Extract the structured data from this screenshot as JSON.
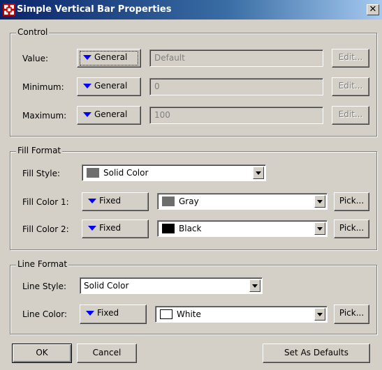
{
  "window": {
    "title": "Simple Vertical Bar Properties",
    "close_glyph": "✕"
  },
  "control": {
    "group_title": "Control",
    "rows": [
      {
        "label": "Value:",
        "mode": "General",
        "field_value": "Default",
        "edit_label": "Edit..."
      },
      {
        "label": "Minimum:",
        "mode": "General",
        "field_value": "0",
        "edit_label": "Edit..."
      },
      {
        "label": "Maximum:",
        "mode": "General",
        "field_value": "100",
        "edit_label": "Edit..."
      }
    ]
  },
  "fill_format": {
    "group_title": "Fill Format",
    "fill_style": {
      "label": "Fill Style:",
      "value": "Solid Color",
      "swatch_color": "#6e6e6e"
    },
    "fill_color_1": {
      "label": "Fill Color 1:",
      "mode": "Fixed",
      "value": "Gray",
      "swatch_color": "#6e6e6e",
      "pick_label": "Pick..."
    },
    "fill_color_2": {
      "label": "Fill Color 2:",
      "mode": "Fixed",
      "value": "Black",
      "swatch_color": "#000000",
      "pick_label": "Pick..."
    }
  },
  "line_format": {
    "group_title": "Line Format",
    "line_style": {
      "label": "Line Style:",
      "value": "Solid Color"
    },
    "line_color": {
      "label": "Line Color:",
      "mode": "Fixed",
      "value": "White",
      "swatch_color": "#ffffff",
      "pick_label": "Pick..."
    }
  },
  "footer": {
    "ok_label": "OK",
    "cancel_label": "Cancel",
    "defaults_label": "Set As Defaults"
  },
  "colors": {
    "accent_triangle": "#0000ff",
    "title_bar_start": "#0a246a",
    "title_bar_end": "#a6caf0"
  }
}
